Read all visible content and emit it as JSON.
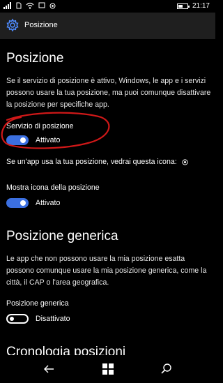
{
  "status": {
    "time": "21:17",
    "icons": [
      "signal-icon",
      "wifi-icon",
      "notification-icon",
      "battery-icon"
    ]
  },
  "header": {
    "title": "Posizione"
  },
  "section1": {
    "title": "Posizione",
    "description": "Se il servizio di posizione è attivo, Windows, le app e i servizi possono usare la tua posizione, ma puoi comunque disattivare la posizione per specifiche app.",
    "location_service_label": "Servizio di posizione",
    "location_service_state": "Attivato",
    "icon_info": "Se un'app usa la tua posizione, vedrai questa icona:",
    "show_icon_label": "Mostra icona della posizione",
    "show_icon_state": "Attivato"
  },
  "section2": {
    "title": "Posizione generica",
    "description": "Le app che non possono usare la mia posizione esatta possono comunque usare la mia posizione generica, come la città, il CAP o l'area geografica.",
    "generic_label": "Posizione generica",
    "generic_state": "Disattivato"
  },
  "section3": {
    "title": "Cronologia posizioni"
  },
  "colors": {
    "accent": "#3b6fe0",
    "header_bg": "#1f1f1f",
    "annotation": "#d01818"
  }
}
